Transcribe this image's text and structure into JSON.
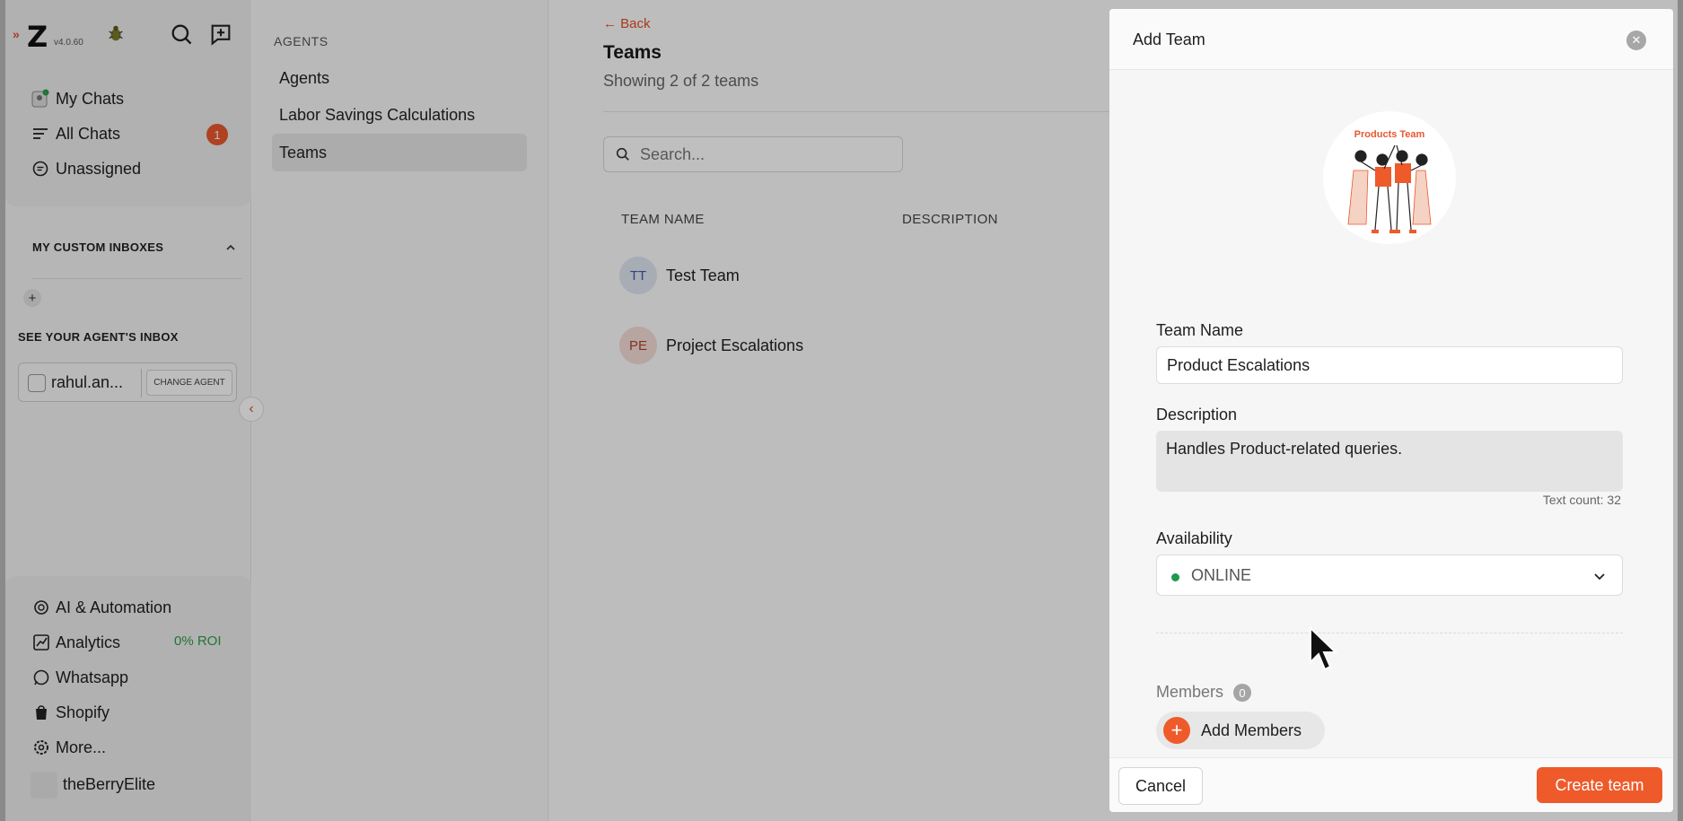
{
  "app": {
    "version": "v4.0.60",
    "brand_color": "#e8582e"
  },
  "sidebar": {
    "nav": [
      {
        "label": "My Chats"
      },
      {
        "label": "All Chats",
        "badge": "1"
      },
      {
        "label": "Unassigned"
      }
    ],
    "custom_inboxes_heading": "MY CUSTOM INBOXES",
    "agent_inbox_heading": "SEE YOUR AGENT'S INBOX",
    "agent_name": "rahul.an...",
    "change_agent_label": "CHANGE AGENT",
    "bottom": [
      {
        "label": "AI & Automation"
      },
      {
        "label": "Analytics",
        "extra": "0% ROI"
      },
      {
        "label": "Whatsapp"
      },
      {
        "label": "Shopify"
      },
      {
        "label": "More..."
      }
    ],
    "org_name": "theBerryElite"
  },
  "settings_nav": {
    "heading": "AGENTS",
    "items": [
      {
        "label": "Agents"
      },
      {
        "label": "Labor Savings Calculations"
      },
      {
        "label": "Teams",
        "active": true
      }
    ]
  },
  "main": {
    "back_label": "← Back",
    "title": "Teams",
    "subtitle": "Showing 2 of 2 teams",
    "search_placeholder": "Search...",
    "columns": [
      "TEAM NAME",
      "DESCRIPTION"
    ],
    "rows": [
      {
        "initials": "TT",
        "name": "Test Team",
        "avatar_bg": "#dfe6f2",
        "avatar_fg": "#3a5ea8"
      },
      {
        "initials": "PE",
        "name": "Project Escalations",
        "avatar_bg": "#f3dcd6",
        "avatar_fg": "#b0422a"
      }
    ]
  },
  "panel": {
    "title": "Add Team",
    "image_label": "Products Team",
    "team_name_label": "Team Name",
    "team_name_value": "Product Escalations",
    "description_label": "Description",
    "description_value": "Handles Product-related queries.",
    "text_count": "Text count: 32",
    "availability_label": "Availability",
    "availability_value": "ONLINE",
    "availability_color": "#1d9a4a",
    "members_label": "Members",
    "members_count": "0",
    "add_members_label": "Add Members",
    "cancel_label": "Cancel",
    "create_label": "Create team"
  }
}
